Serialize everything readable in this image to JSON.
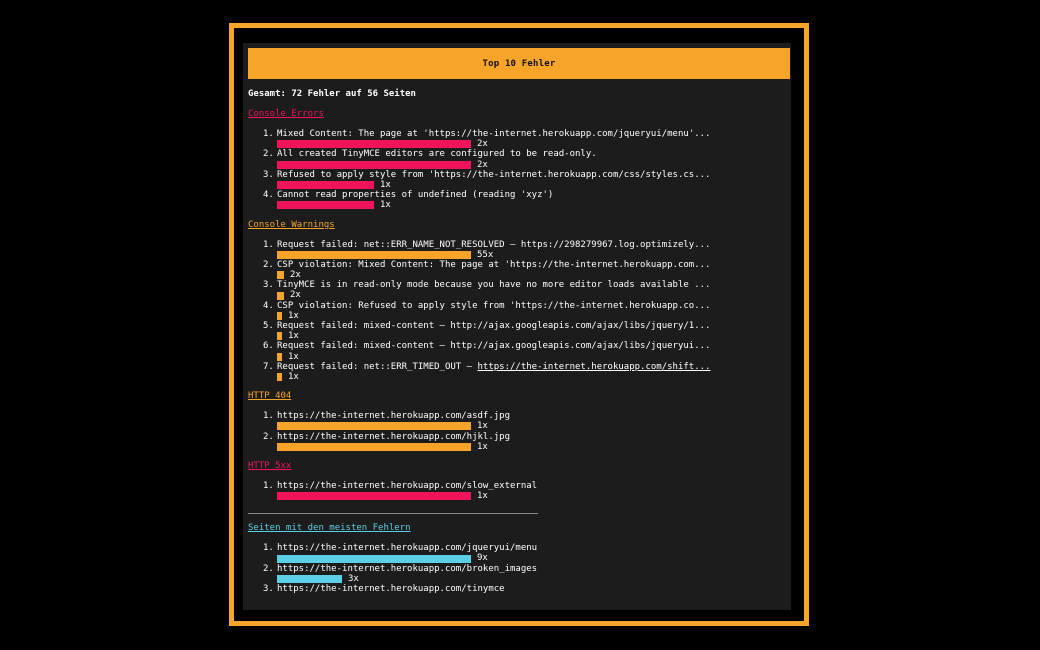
{
  "colors": {
    "accent": "#f7a42a",
    "error": "#f0155a",
    "warning": "#f7a42a",
    "http404": "#f7a42a",
    "http5xx": "#f0155a",
    "pages": "#5ccfe6",
    "panel_bg": "#1c1c1c"
  },
  "header": {
    "title": "Top 10 Fehler"
  },
  "summary": {
    "text": "Gesamt: 72 Fehler auf 56 Seiten"
  },
  "sections": [
    {
      "title": "Console Errors",
      "color": "#f0155a",
      "max": 2,
      "items": [
        {
          "num": "1.",
          "text": "Mixed Content: The page at 'https://the-internet.herokuapp.com/jqueryui/menu'...",
          "count_value": 2,
          "count": "2x"
        },
        {
          "num": "2.",
          "text": "All created TinyMCE editors are configured to be read-only.",
          "count_value": 2,
          "count": "2x"
        },
        {
          "num": "3.",
          "text": "Refused to apply style from 'https://the-internet.herokuapp.com/css/styles.cs...",
          "count_value": 1,
          "count": "1x"
        },
        {
          "num": "4.",
          "text": "Cannot read properties of undefined (reading 'xyz')",
          "count_value": 1,
          "count": "1x"
        }
      ]
    },
    {
      "title": "Console Warnings",
      "color": "#f7a42a",
      "max": 55,
      "items": [
        {
          "num": "1.",
          "text": "Request failed: net::ERR_NAME_NOT_RESOLVED – https://298279967.log.optimizely...",
          "count_value": 55,
          "count": "55x"
        },
        {
          "num": "2.",
          "text": "CSP violation: Mixed Content: The page at 'https://the-internet.herokuapp.com...",
          "count_value": 2,
          "count": "2x"
        },
        {
          "num": "3.",
          "text": "TinyMCE is in read-only mode because you have no more editor loads available ...",
          "count_value": 2,
          "count": "2x"
        },
        {
          "num": "4.",
          "text": "CSP violation: Refused to apply style from 'https://the-internet.herokuapp.co...",
          "count_value": 1,
          "count": "1x"
        },
        {
          "num": "5.",
          "text": "Request failed: mixed-content – http://ajax.googleapis.com/ajax/libs/jquery/1...",
          "count_value": 1,
          "count": "1x"
        },
        {
          "num": "6.",
          "text": "Request failed: mixed-content – http://ajax.googleapis.com/ajax/libs/jqueryui...",
          "count_value": 1,
          "count": "1x"
        },
        {
          "num": "7.",
          "text": "Request failed: net::ERR_TIMED_OUT – ",
          "link": "https://the-internet.herokuapp.com/shift...",
          "count_value": 1,
          "count": "1x"
        }
      ]
    },
    {
      "title": "HTTP 404",
      "color": "#f7a42a",
      "max": 1,
      "items": [
        {
          "num": "1.",
          "text": "https://the-internet.herokuapp.com/asdf.jpg",
          "count_value": 1,
          "count": "1x"
        },
        {
          "num": "2.",
          "text": "https://the-internet.herokuapp.com/hjkl.jpg",
          "count_value": 1,
          "count": "1x"
        }
      ]
    },
    {
      "title": "HTTP 5xx",
      "color": "#f0155a",
      "max": 1,
      "items": [
        {
          "num": "1.",
          "text": "https://the-internet.herokuapp.com/slow_external",
          "count_value": 1,
          "count": "1x"
        }
      ]
    }
  ],
  "pages_section": {
    "title": "Seiten mit den meisten Fehlern",
    "color": "#5ccfe6",
    "max": 9,
    "items": [
      {
        "num": "1.",
        "text": "https://the-internet.herokuapp.com/jqueryui/menu",
        "count_value": 9,
        "count": "9x"
      },
      {
        "num": "2.",
        "text": "https://the-internet.herokuapp.com/broken_images",
        "count_value": 3,
        "count": "3x"
      },
      {
        "num": "3.",
        "text": "https://the-internet.herokuapp.com/tinymce",
        "count_value": null,
        "count": ""
      }
    ]
  }
}
